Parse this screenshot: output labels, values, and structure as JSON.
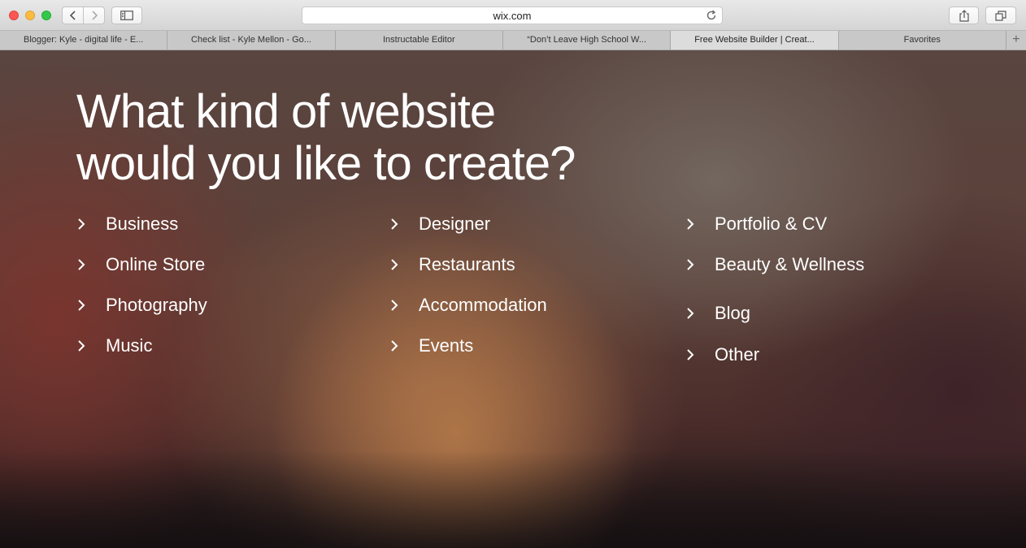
{
  "browser": {
    "url": "wix.com",
    "tabs": [
      {
        "label": "Blogger: Kyle - digital life - E...",
        "active": false
      },
      {
        "label": "Check list - Kyle Mellon - Go...",
        "active": false
      },
      {
        "label": "Instructable Editor",
        "active": false
      },
      {
        "label": "“Don’t Leave High School W...",
        "active": false
      },
      {
        "label": "Free Website Builder | Creat...",
        "active": true
      },
      {
        "label": "Favorites",
        "active": false
      }
    ],
    "new_tab": "+"
  },
  "page": {
    "headline": {
      "line1": "What kind of website",
      "line2": "would you like to create?"
    },
    "columns": [
      [
        "Business",
        "Online Store",
        "Photography",
        "Music"
      ],
      [
        "Designer",
        "Restaurants",
        "Accommodation",
        "Events"
      ],
      [
        "Portfolio & CV",
        "Beauty & Wellness",
        "Blog",
        "Other"
      ]
    ],
    "chevron_icon": "chevron-right-icon"
  }
}
